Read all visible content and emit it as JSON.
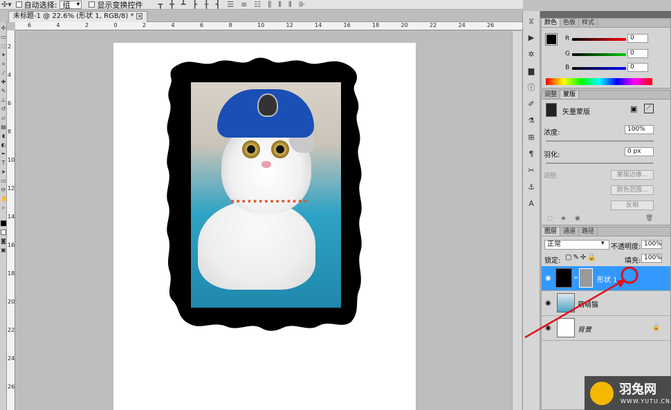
{
  "options_bar": {
    "auto_select_label": "自动选择:",
    "auto_select_value": "组",
    "show_transform_label": "显示变换控件"
  },
  "document": {
    "tab_title": "未标题-1 @ 22.6% (形状 1, RGB/8) *",
    "close_glyph": "×",
    "ruler_h_ticks": [
      "6",
      "4",
      "2",
      "0",
      "2",
      "4",
      "6",
      "8",
      "10",
      "12",
      "14",
      "16",
      "18",
      "20",
      "22",
      "24",
      "26"
    ],
    "ruler_v_ticks": [
      "2",
      "4",
      "6",
      "8",
      "10",
      "12",
      "14",
      "16",
      "18",
      "20",
      "22",
      "24",
      "26"
    ]
  },
  "color_panel": {
    "tabs": [
      "颜色",
      "色板",
      "样式"
    ],
    "r_label": "R",
    "g_label": "G",
    "b_label": "B",
    "r_value": "0",
    "g_value": "0",
    "b_value": "0"
  },
  "mask_panel": {
    "tabs": [
      "调整",
      "蒙版"
    ],
    "mask_type": "矢量蒙版",
    "density_label": "浓度:",
    "density_value": "100%",
    "feather_label": "羽化:",
    "feather_value": "0 px",
    "adjust_label": "调整:",
    "mask_edge_button": "蒙版边缘...",
    "color_range_button": "颜色范围...",
    "invert_button": "反相"
  },
  "layers_panel": {
    "tabs": [
      "图层",
      "通道",
      "路径"
    ],
    "blend_mode": "正常",
    "opacity_label": "不透明度:",
    "opacity_value": "100%",
    "lock_label": "锁定:",
    "fill_label": "填充:",
    "fill_value": "100%",
    "layers": [
      {
        "name": "形状 1"
      },
      {
        "name": "萌萌猫"
      },
      {
        "name": "背景"
      }
    ]
  },
  "watermark": {
    "brand": "羽兔网",
    "url": "WWW.YUTU.CN"
  },
  "colors": {
    "accent_select": "#3399ff",
    "annotation_red": "#e0101a"
  }
}
